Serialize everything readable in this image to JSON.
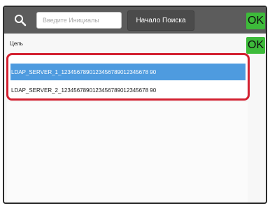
{
  "toolbar": {
    "search_icon": "search-icon",
    "initials_placeholder": "Введите Инициалы",
    "initials_value": "",
    "start_search_label": "Начало Поиска",
    "ok_label": "OK"
  },
  "secondary": {
    "ok_label": "OK"
  },
  "target": {
    "label": "Цель"
  },
  "list": {
    "items": [
      {
        "label": "LDAP_SERVER_1_1234567890123456789012345678 90",
        "selected": true
      },
      {
        "label": "LDAP_SERVER_2_1234567890123456789012345678 90",
        "selected": false
      }
    ]
  },
  "colors": {
    "toolbar_bg": "#5c5c5c",
    "ok_green": "#3dbb3a",
    "selected_blue": "#4e9bdf",
    "highlight_red": "#d32030"
  }
}
